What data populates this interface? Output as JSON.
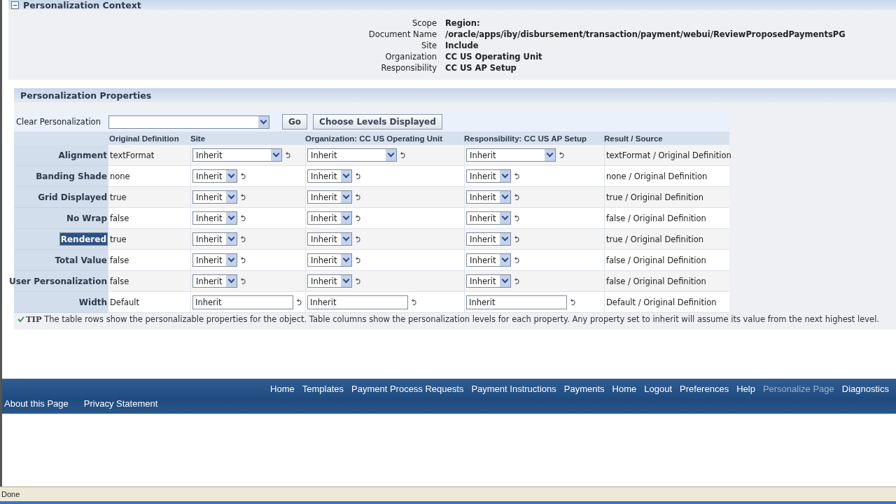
{
  "context": {
    "title": "Personalization Context",
    "expanded": true,
    "fields": [
      {
        "label": "Scope",
        "value": "Region:"
      },
      {
        "label": "Document Name",
        "value": "/oracle/apps/iby/disbursement/transaction/payment/webui/ReviewProposedPaymentsPG"
      },
      {
        "label": "Site",
        "value": "Include"
      },
      {
        "label": "Organization",
        "value": "CC US Operating Unit"
      },
      {
        "label": "Responsibility",
        "value": "CC US AP Setup"
      }
    ]
  },
  "properties": {
    "title": "Personalization Properties",
    "clear_label": "Clear Personalization",
    "go_button": "Go",
    "levels_button": "Choose Levels Displayed",
    "columns": [
      "Original Definition",
      "Site",
      "Organization: CC US Operating Unit",
      "Responsibility: CC US AP Setup",
      "Result / Source"
    ],
    "rows": [
      {
        "label": "Alignment",
        "selected": false,
        "original": "textFormat",
        "kind": "list",
        "values": [
          "Inherit",
          "Inherit",
          "Inherit"
        ],
        "result": "textFormat / Original Definition"
      },
      {
        "label": "Banding Shade",
        "selected": false,
        "original": "none",
        "kind": "select",
        "values": [
          "Inherit",
          "Inherit",
          "Inherit"
        ],
        "result": "none / Original Definition"
      },
      {
        "label": "Grid Displayed",
        "selected": false,
        "original": "true",
        "kind": "select",
        "values": [
          "Inherit",
          "Inherit",
          "Inherit"
        ],
        "result": "true / Original Definition"
      },
      {
        "label": "No Wrap",
        "selected": false,
        "original": "false",
        "kind": "select",
        "values": [
          "Inherit",
          "Inherit",
          "Inherit"
        ],
        "result": "false / Original Definition"
      },
      {
        "label": "Rendered",
        "selected": true,
        "original": "true",
        "kind": "select",
        "values": [
          "Inherit",
          "Inherit",
          "Inherit"
        ],
        "result": "true / Original Definition"
      },
      {
        "label": "Total Value",
        "selected": false,
        "original": "false",
        "kind": "select",
        "values": [
          "Inherit",
          "Inherit",
          "Inherit"
        ],
        "result": "false / Original Definition"
      },
      {
        "label": "User Personalization",
        "selected": false,
        "original": "false",
        "kind": "select",
        "values": [
          "Inherit",
          "Inherit",
          "Inherit"
        ],
        "result": "false / Original Definition"
      },
      {
        "label": "Width",
        "selected": false,
        "original": "Default",
        "kind": "text",
        "values": [
          "Inherit",
          "Inherit",
          "Inherit"
        ],
        "result": "Default / Original Definition"
      }
    ],
    "tip_label": "TIP",
    "tip": "The table rows show the personalizable properties for the object. Table columns show the personalization levels for each property. Any property set to inherit will assume its value from the next highest level."
  },
  "footer": {
    "links": [
      {
        "label": "Home",
        "disabled": false
      },
      {
        "label": "Templates",
        "disabled": false
      },
      {
        "label": "Payment Process Requests",
        "disabled": false
      },
      {
        "label": "Payment Instructions",
        "disabled": false
      },
      {
        "label": "Payments",
        "disabled": false
      },
      {
        "label": "Home",
        "disabled": false
      },
      {
        "label": "Logout",
        "disabled": false
      },
      {
        "label": "Preferences",
        "disabled": false
      },
      {
        "label": "Help",
        "disabled": false
      },
      {
        "label": "Personalize Page",
        "disabled": true
      },
      {
        "label": "Diagnostics",
        "disabled": false
      }
    ],
    "bottom_links": [
      "About this Page",
      "Privacy Statement"
    ]
  },
  "status_bar": "Done"
}
